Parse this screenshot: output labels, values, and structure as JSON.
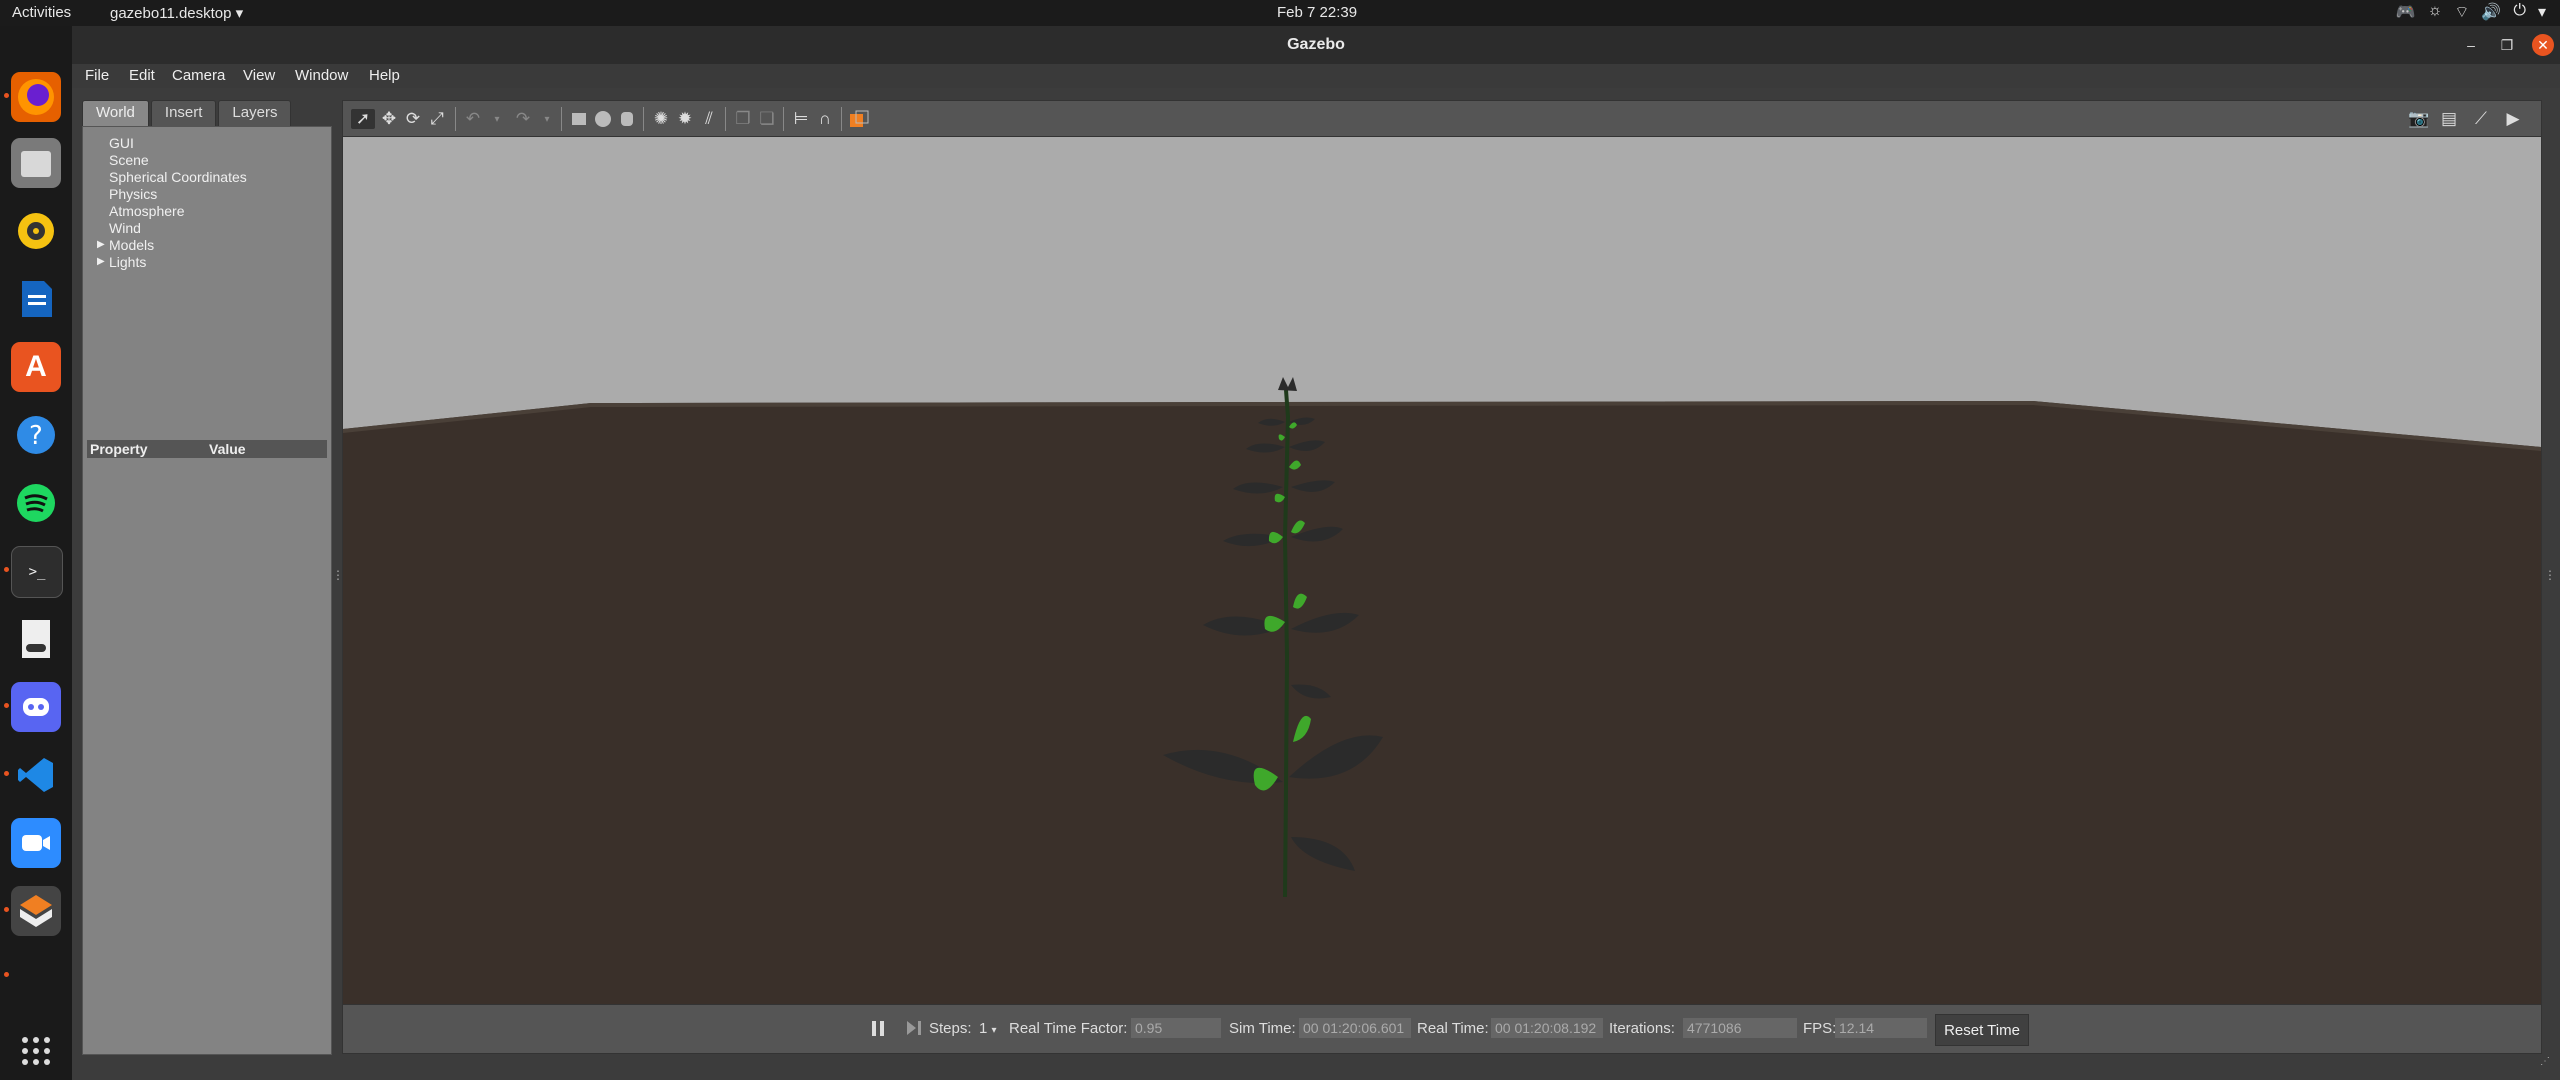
{
  "topbar": {
    "activities": "Activities",
    "app_menu": "gazebo11.desktop",
    "clock": "Feb 7  22:39"
  },
  "window": {
    "title": "Gazebo"
  },
  "menu": [
    "File",
    "Edit",
    "Camera",
    "View",
    "Window",
    "Help"
  ],
  "left_panel": {
    "tabs": [
      "World",
      "Insert",
      "Layers"
    ],
    "active_tab": "World",
    "tree": [
      "GUI",
      "Scene",
      "Spherical Coordinates",
      "Physics",
      "Atmosphere",
      "Wind",
      "Models",
      "Lights"
    ],
    "property_header": "Property",
    "value_header": "Value"
  },
  "toolbar_icons": [
    "select-arrow-icon",
    "translate-icon",
    "rotate-icon",
    "scale-icon",
    "undo-icon",
    "undo-dropdown-icon",
    "redo-icon",
    "redo-dropdown-icon",
    "box-icon",
    "sphere-icon",
    "cylinder-icon",
    "point-light-icon",
    "spot-light-icon",
    "directional-light-icon",
    "copy-icon",
    "paste-icon",
    "align-icon",
    "snap-icon",
    "view-angle-icon",
    "screenshot-icon",
    "log-icon",
    "plot-icon",
    "video-icon"
  ],
  "bottom_bar": {
    "steps_label": "Steps:",
    "steps_value": "1",
    "rtf_label": "Real Time Factor:",
    "rtf_value": "0.95",
    "sim_time_label": "Sim Time:",
    "sim_time_value": "00 01:20:06.601",
    "real_time_label": "Real Time:",
    "real_time_value": "00 01:20:08.192",
    "iterations_label": "Iterations:",
    "iterations_value": "4771086",
    "fps_label": "FPS:",
    "fps_value": "12.14",
    "reset_label": "Reset Time"
  },
  "colors": {
    "accent": "#e95420",
    "sky": "#ababab",
    "ground": "#3a302a",
    "leaf_green": "#3fa82b",
    "leaf_dark": "#2a2a2a",
    "panel": "#838383"
  }
}
